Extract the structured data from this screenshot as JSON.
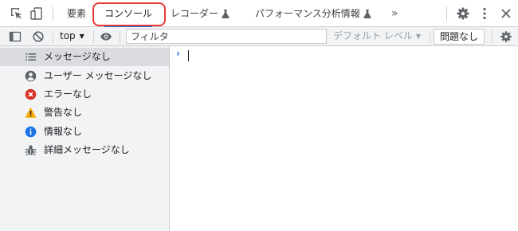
{
  "tabs": [
    {
      "label": "要素"
    },
    {
      "label": "コンソール"
    },
    {
      "label": "レコーダー"
    },
    {
      "label": "パフォーマンス分析情報"
    }
  ],
  "more_tabs": "»",
  "toolbar": {
    "context": "top",
    "filter_placeholder": "フィルタ",
    "levels": "デフォルト レベル",
    "issues": "問題なし"
  },
  "sidebar": {
    "items": [
      {
        "label": "メッセージなし",
        "icon": "list-icon"
      },
      {
        "label": "ユーザー メッセージなし",
        "icon": "user-icon"
      },
      {
        "label": "エラーなし",
        "icon": "error-icon"
      },
      {
        "label": "警告なし",
        "icon": "warning-icon"
      },
      {
        "label": "情報なし",
        "icon": "info-icon"
      },
      {
        "label": "詳細メッセージなし",
        "icon": "bug-icon"
      }
    ]
  },
  "console": {
    "prompt": "›"
  },
  "colors": {
    "accent": "#1a73e8",
    "error": "#d93025",
    "warning": "#f9ab00",
    "info": "#1a73e8",
    "highlight": "#e53935"
  }
}
